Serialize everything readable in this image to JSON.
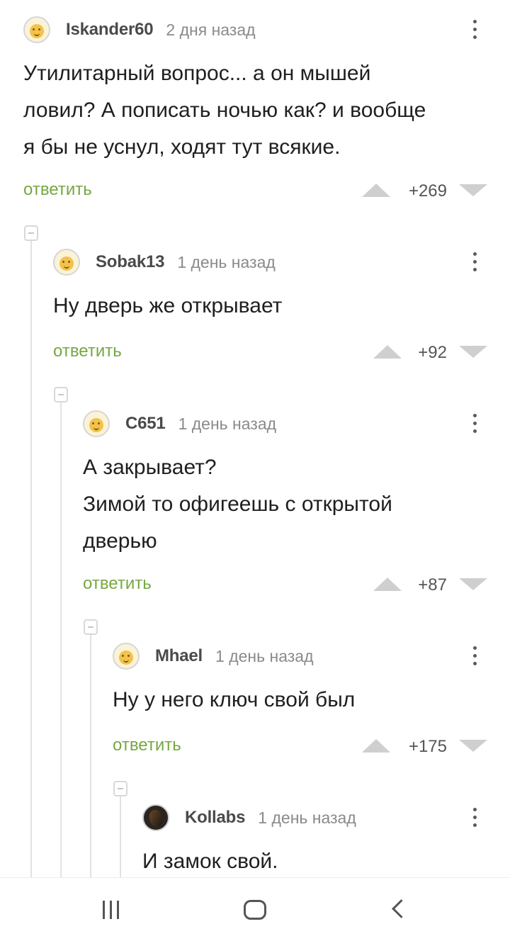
{
  "comments": [
    {
      "username": "Iskander60",
      "time": "2 дня назад",
      "avatar": "sleepy-face-icon",
      "lines": [
        "Утилитарный вопрос... а он мышей",
        "ловил? А пописать ночью как? и вообще",
        "я бы не уснул, ходят тут всякие."
      ],
      "reply_label": "ответить",
      "score": "+269"
    },
    {
      "username": "Sobak13",
      "time": "1 день назад",
      "avatar": "sleepy-face-icon",
      "lines": [
        "Ну дверь же открывает"
      ],
      "reply_label": "ответить",
      "score": "+92"
    },
    {
      "username": "C651",
      "time": "1 день назад",
      "avatar": "sleepy-face-icon",
      "lines": [
        "А закрывает?",
        "Зимой то офигеешь с открытой",
        "дверью"
      ],
      "reply_label": "ответить",
      "score": "+87"
    },
    {
      "username": "Mhael",
      "time": "1 день назад",
      "avatar": "sleepy-face-icon",
      "lines": [
        "Ну у него ключ свой был"
      ],
      "reply_label": "ответить",
      "score": "+175"
    },
    {
      "username": "Kollabs",
      "time": "1 день назад",
      "avatar": "user-photo-avatar",
      "lines": [
        "И замок свой."
      ]
    }
  ],
  "colors": {
    "reply": "#77a743",
    "username": "#4a4a4a",
    "time": "#8a8a8a"
  },
  "navbar": {
    "icons": [
      "recent-apps-icon",
      "home-icon",
      "back-icon"
    ]
  }
}
